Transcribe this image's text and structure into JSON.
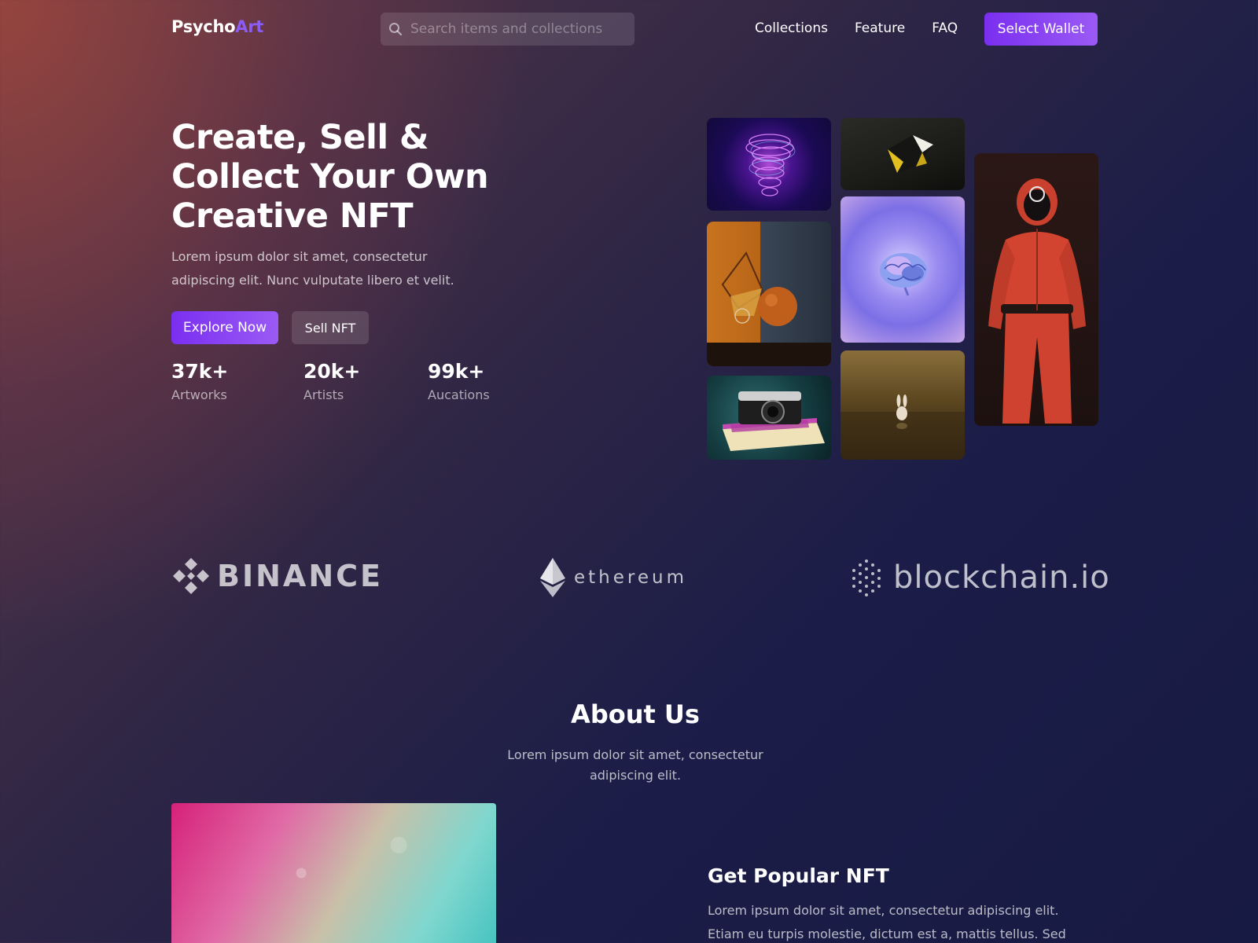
{
  "brand": {
    "name_main": "Psycho",
    "name_accent": "Art",
    "accent_color": "#8b5cf6"
  },
  "search": {
    "placeholder": "Search items and collections",
    "value": ""
  },
  "nav": {
    "links": [
      "Collections",
      "Feature",
      "FAQ"
    ],
    "wallet_button": "Select Wallet"
  },
  "hero": {
    "title": "Create, Sell & Collect Your Own Creative NFT",
    "description": "Lorem ipsum dolor sit amet, consectetur adipiscing elit. Nunc vulputate libero et velit.",
    "primary_button": "Explore Now",
    "secondary_button": "Sell NFT",
    "stats": [
      {
        "value": "37k+",
        "label": "Artworks"
      },
      {
        "value": "20k+",
        "label": "Artists"
      },
      {
        "value": "99k+",
        "label": "Aucations"
      }
    ]
  },
  "gallery": {
    "tiles": [
      {
        "icon": "glitch-skull-art"
      },
      {
        "icon": "black-gold-geometric-art"
      },
      {
        "icon": "orange-sphere-still-life-art"
      },
      {
        "icon": "brain-art"
      },
      {
        "icon": "red-jumpsuit-figure-art"
      },
      {
        "icon": "camera-on-book-art"
      },
      {
        "icon": "tiny-rabbit-art"
      }
    ]
  },
  "partners": [
    "BINANCE",
    "ethereum",
    "blockchain.io"
  ],
  "about": {
    "title": "About Us",
    "description": "Lorem ipsum dolor sit amet, consectetur adipiscing elit.",
    "feature_title": "Get Popular NFT",
    "feature_description": "Lorem ipsum dolor sit amet, consectetur adipiscing elit. Etiam eu turpis molestie, dictum est a, mattis tellus. Sed"
  },
  "colors": {
    "primary_gradient_start": "#7a2ff0",
    "primary_gradient_end": "#9b5af5"
  }
}
